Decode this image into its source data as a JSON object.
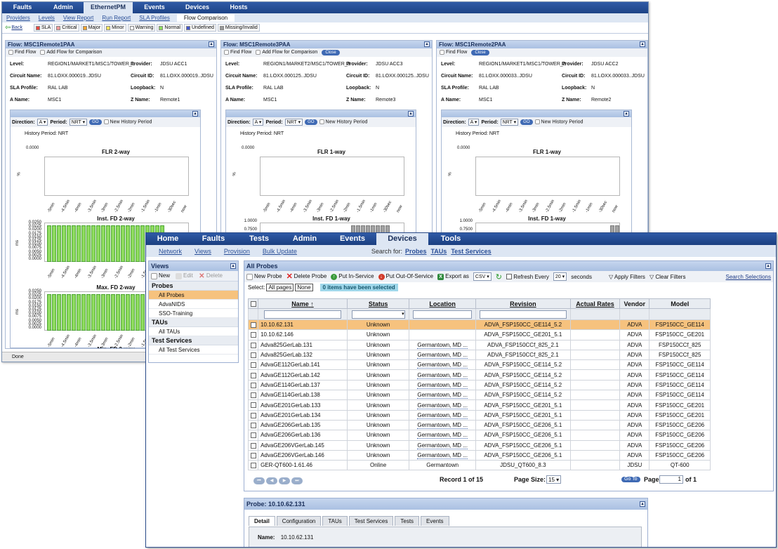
{
  "back_window": {
    "nav": [
      "Faults",
      "Admin",
      "EthernetPM",
      "Events",
      "Devices",
      "Hosts"
    ],
    "selected_nav": "EthernetPM",
    "subnav": [
      "Providers",
      "Levels",
      "View Report",
      "Run Report",
      "SLA Profiles",
      "Flow Comparison"
    ],
    "back_label": "Back",
    "legend": [
      {
        "label": "SLA",
        "color": "#e8483f"
      },
      {
        "label": "Critical",
        "color": "#f29a9a"
      },
      {
        "label": "Major",
        "color": "#f4a531"
      },
      {
        "label": "Minor",
        "color": "#f7e35b"
      },
      {
        "label": "Warning",
        "color": "#ffffff"
      },
      {
        "label": "Normal",
        "color": "#8fdc5f"
      },
      {
        "label": "Undefined",
        "color": "#4457c9"
      },
      {
        "label": "Missing/Invalid",
        "color": "#9a9a9a"
      }
    ],
    "status_text": "Done",
    "panes": [
      {
        "title": "Flow: MSC1Remote1PAA",
        "find": "Find Flow",
        "add": "Add Flow for Comparison",
        "close": "",
        "level": "REGION1/MARKET1/MSC1/TOWER_1",
        "provider": "JDSU ACC1",
        "circuit_name": "81.LOXX.000019..JDSU",
        "circuit_id": "81.LOXX.000019..JDSU",
        "sla_profile": "RAL LAB",
        "loopback": "N",
        "a_name": "MSC1",
        "z_name": "Remote1",
        "direction": "A",
        "period": "NRT",
        "go": "GO",
        "new_history": "New History Period",
        "history_period": "History Period: NRT",
        "chart1": "FLR 2-way",
        "chart1_y": "0.0000",
        "chart2": "Inst. FD 2-way",
        "chart2_y": [
          "0.0250",
          "0.0225",
          "0.0200",
          "0.0175",
          "0.0150",
          "0.0125",
          "0.0100",
          "0.0075",
          "0.0050",
          "0.0025",
          "0.0000"
        ],
        "chart3": "Max. FD 2-way",
        "chart3_y": [
          "0.0250",
          "0.0225",
          "0.0200",
          "0.0175",
          "0.0150",
          "0.0125",
          "0.0100",
          "0.0075",
          "0.0050",
          "0.0025",
          "0.0000"
        ],
        "chart4": "Min. FD 2-way"
      },
      {
        "title": "Flow: MSC1Remote3PAA",
        "find": "Find Flow",
        "add": "Add Flow for Comparison",
        "close": "Close",
        "level": "REGION1/MARKET2/MSC1/TOWER_3",
        "provider": "JDSU ACC3",
        "circuit_name": "81.LOXX.000125..JDSU",
        "circuit_id": "81.LOXX.000125..JDSU",
        "sla_profile": "RAL LAB",
        "loopback": "N",
        "a_name": "MSC1",
        "z_name": "Remote3",
        "direction": "A",
        "period": "NRT",
        "go": "GO",
        "new_history": "New History Period",
        "history_period": "History Period: NRT",
        "chart1": "FLR 1-way",
        "chart1_y": "0.0000",
        "chart2": "Inst. FD 1-way",
        "chart2_y": [
          "1.0000",
          "0.7500"
        ]
      },
      {
        "title": "Flow: MSC1Remote2PAA",
        "find": "Find Flow",
        "add": "",
        "close": "Close",
        "level": "REGION1/MARKET1/MSC1/TOWER_2",
        "provider": "JDSU ACC2",
        "circuit_name": "81.LOXX.000033..JDSU",
        "circuit_id": "81.LOXX.000033..JDSU",
        "sla_profile": "RAL LAB",
        "loopback": "N",
        "a_name": "MSC1",
        "z_name": "Remote2",
        "direction": "A",
        "period": "NRT",
        "go": "GO",
        "new_history": "New History Period",
        "history_period": "History Period: NRT",
        "chart1": "FLR 1-way",
        "chart1_y": "0.0000",
        "chart2": "Inst. FD 1-way",
        "chart2_y": [
          "1.0000",
          "0.7500"
        ]
      }
    ],
    "labels": {
      "level": "Level:",
      "provider": "Provider:",
      "circuit_name": "Circuit Name:",
      "circuit_id": "Circuit ID:",
      "sla_profile": "SLA Profile:",
      "loopback": "Loopback:",
      "a_name": "A Name:",
      "z_name": "Z Name:",
      "direction": "Direction:",
      "period": "Period:"
    },
    "x_ticks": [
      "-5min",
      "-4.5min",
      "-4min",
      "-3.5min",
      "-3min",
      "-2.5min",
      "-2min",
      "-1.5min",
      "-1min",
      "-30sec",
      "now"
    ],
    "unit": "%",
    "unit_ms": "ms"
  },
  "front_window": {
    "nav": [
      "Home",
      "Faults",
      "Tests",
      "Admin",
      "Events",
      "Devices",
      "Tools"
    ],
    "selected_nav": "Devices",
    "subnav": [
      "Network",
      "Views",
      "Provision",
      "Bulk Update"
    ],
    "search_label": "Search for:",
    "search_links": [
      "Probes",
      "TAUs",
      "Test Services"
    ],
    "views": {
      "title": "Views",
      "new": "New",
      "edit": "Edit",
      "delete": "Delete",
      "groups": [
        {
          "name": "Probes",
          "items": [
            "All Probes",
            "AdvaNIDS",
            "SSO-Training"
          ]
        },
        {
          "name": "TAUs",
          "items": [
            "All TAUs"
          ]
        },
        {
          "name": "Test Services",
          "items": [
            "All Test Services"
          ]
        }
      ],
      "selected": "All Probes"
    },
    "probes": {
      "title": "All Probes",
      "new": "New Probe",
      "delete": "Delete Probe",
      "put_in": "Put In-Service",
      "put_out": "Put Out-Of-Service",
      "export": "Export as",
      "export_fmt": "CSV",
      "refresh": "Refresh Every",
      "refresh_val": "20",
      "seconds": "seconds",
      "apply": "Apply Filters",
      "clear": "Clear Filters",
      "search_sel": "Search Selections",
      "select_label": "Select:",
      "all_pages": "All pages",
      "none": "None",
      "selected_note": "0 items have been selected",
      "columns": [
        "Name",
        "Status",
        "Location",
        "Revision",
        "Actual Rates",
        "Vendor",
        "Model"
      ],
      "rows": [
        [
          "10.10.62.131",
          "Unknown",
          "",
          "ADVA_FSP150CC_GE114_5.2",
          "",
          "ADVA",
          "FSP150CC_GE114"
        ],
        [
          "10.10.62.146",
          "Unknown",
          "",
          "ADVA_FSP150CC_GE201_5.1",
          "",
          "ADVA",
          "FSP150CC_GE201"
        ],
        [
          "Adva825GerLab.131",
          "Unknown",
          "Germantown, MD ...",
          "ADVA_FSP150CCf_825_2.1",
          "",
          "ADVA",
          "FSP150CCf_825"
        ],
        [
          "Adva825GerLab.132",
          "Unknown",
          "Germantown, MD ...",
          "ADVA_FSP150CCf_825_2.1",
          "",
          "ADVA",
          "FSP150CCf_825"
        ],
        [
          "AdvaGE112GerLab.141",
          "Unknown",
          "Germantown, MD ...",
          "ADVA_FSP150CC_GE114_5.2",
          "",
          "ADVA",
          "FSP150CC_GE114"
        ],
        [
          "AdvaGE112GerLab.142",
          "Unknown",
          "Germantown, MD ...",
          "ADVA_FSP150CC_GE114_5.2",
          "",
          "ADVA",
          "FSP150CC_GE114"
        ],
        [
          "AdvaGE114GerLab.137",
          "Unknown",
          "Germantown, MD ...",
          "ADVA_FSP150CC_GE114_5.2",
          "",
          "ADVA",
          "FSP150CC_GE114"
        ],
        [
          "AdvaGE114GerLab.138",
          "Unknown",
          "Germantown, MD ...",
          "ADVA_FSP150CC_GE114_5.2",
          "",
          "ADVA",
          "FSP150CC_GE114"
        ],
        [
          "AdvaGE201GerLab.133",
          "Unknown",
          "Germantown, MD ...",
          "ADVA_FSP150CC_GE201_5.1",
          "",
          "ADVA",
          "FSP150CC_GE201"
        ],
        [
          "AdvaGE201GerLab.134",
          "Unknown",
          "Germantown, MD ...",
          "ADVA_FSP150CC_GE201_5.1",
          "",
          "ADVA",
          "FSP150CC_GE201"
        ],
        [
          "AdvaGE206GerLab.135",
          "Unknown",
          "Germantown, MD ...",
          "ADVA_FSP150CC_GE206_5.1",
          "",
          "ADVA",
          "FSP150CC_GE206"
        ],
        [
          "AdvaGE206GerLab.136",
          "Unknown",
          "Germantown, MD ...",
          "ADVA_FSP150CC_GE206_5.1",
          "",
          "ADVA",
          "FSP150CC_GE206"
        ],
        [
          "AdvaGE206VGerLab.145",
          "Unknown",
          "Germantown, MD ...",
          "ADVA_FSP150CC_GE206_5.1",
          "",
          "ADVA",
          "FSP150CC_GE206"
        ],
        [
          "AdvaGE206VGerLab.146",
          "Unknown",
          "Germantown, MD ...",
          "ADVA_FSP150CC_GE206_5.1",
          "",
          "ADVA",
          "FSP150CC_GE206"
        ],
        [
          "GER-QT600-1.61.46",
          "Online",
          "Germantown",
          "JDSU_QT600_8.3",
          "",
          "JDSU",
          "QT-600"
        ]
      ],
      "record": "Record 1 of 15",
      "page_size_label": "Page Size:",
      "page_size": "15",
      "goto": "Go To",
      "page_label": "Page",
      "page": "1",
      "of": "of 1"
    },
    "detail": {
      "title": "Probe: 10.10.62.131",
      "tabs": [
        "Detail",
        "Configuration",
        "TAUs",
        "Test Services",
        "Tests",
        "Events"
      ],
      "name_label": "Name:",
      "name": "10.10.62.131"
    }
  }
}
